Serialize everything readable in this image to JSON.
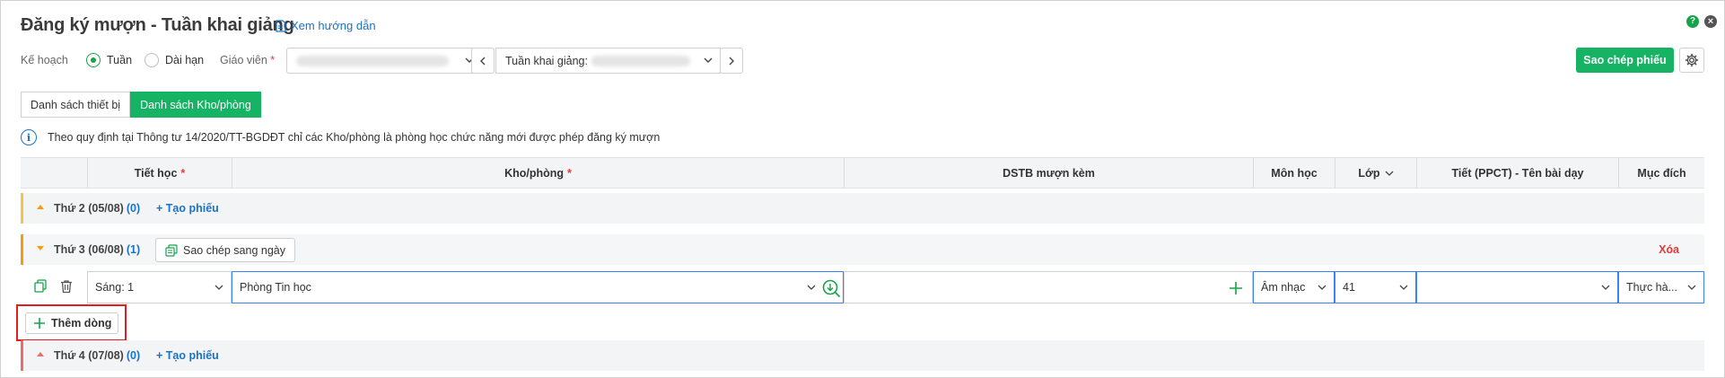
{
  "header": {
    "title": "Đăng ký mượn - Tuần khai giảng",
    "guide_link": "Xem hướng dẫn",
    "help_icon": "?",
    "close_icon": "×"
  },
  "filters": {
    "plan_label": "Kế hoạch",
    "plan_options": [
      "Tuần",
      "Dài hạn"
    ],
    "plan_selected": "Tuần",
    "teacher_label": "Giáo viên",
    "required_mark": "*",
    "week_label": "Tuần khai giảng:",
    "copy_ticket_button": "Sao chép phiếu"
  },
  "tabs": [
    {
      "label": "Danh sách thiết bị",
      "active": false
    },
    {
      "label": "Danh sách Kho/phòng",
      "active": true
    }
  ],
  "notice": {
    "icon": "i",
    "text": "Theo quy định tại Thông tư 14/2020/TT-BGDĐT chỉ các Kho/phòng là phòng học chức năng mới được phép đăng ký mượn"
  },
  "table": {
    "columns": {
      "period": "Tiết học",
      "room": "Kho/phòng",
      "equipment": "DSTB mượn kèm",
      "subject": "Môn học",
      "class": "Lớp",
      "lesson": "Tiết (PPCT) - Tên bài dạy",
      "purpose": "Mục đích"
    },
    "groups": [
      {
        "title": "Thứ 2 (05/08)",
        "count": "(0)",
        "create": "+ Tạo phiếu",
        "color": "#f5c542"
      },
      {
        "title": "Thứ 3 (06/08)",
        "count": "(1)",
        "copy_day": "Sao chép sang ngày",
        "delete": "Xóa",
        "color": "#f59e0b"
      },
      {
        "title": "Thứ 4 (07/08)",
        "count": "(0)",
        "create": "+ Tạo phiếu",
        "color": "#ef6b6b"
      }
    ],
    "row": {
      "period": "Sáng: 1",
      "room": "Phòng Tin học",
      "equipment": "",
      "subject": "Âm nhạc",
      "class": "41",
      "lesson": "",
      "purpose": "Thực hà..."
    },
    "add_row_button": "Thêm dòng"
  },
  "colors": {
    "accent": "#16b364",
    "link": "#1a73c8",
    "danger": "#e53935"
  }
}
